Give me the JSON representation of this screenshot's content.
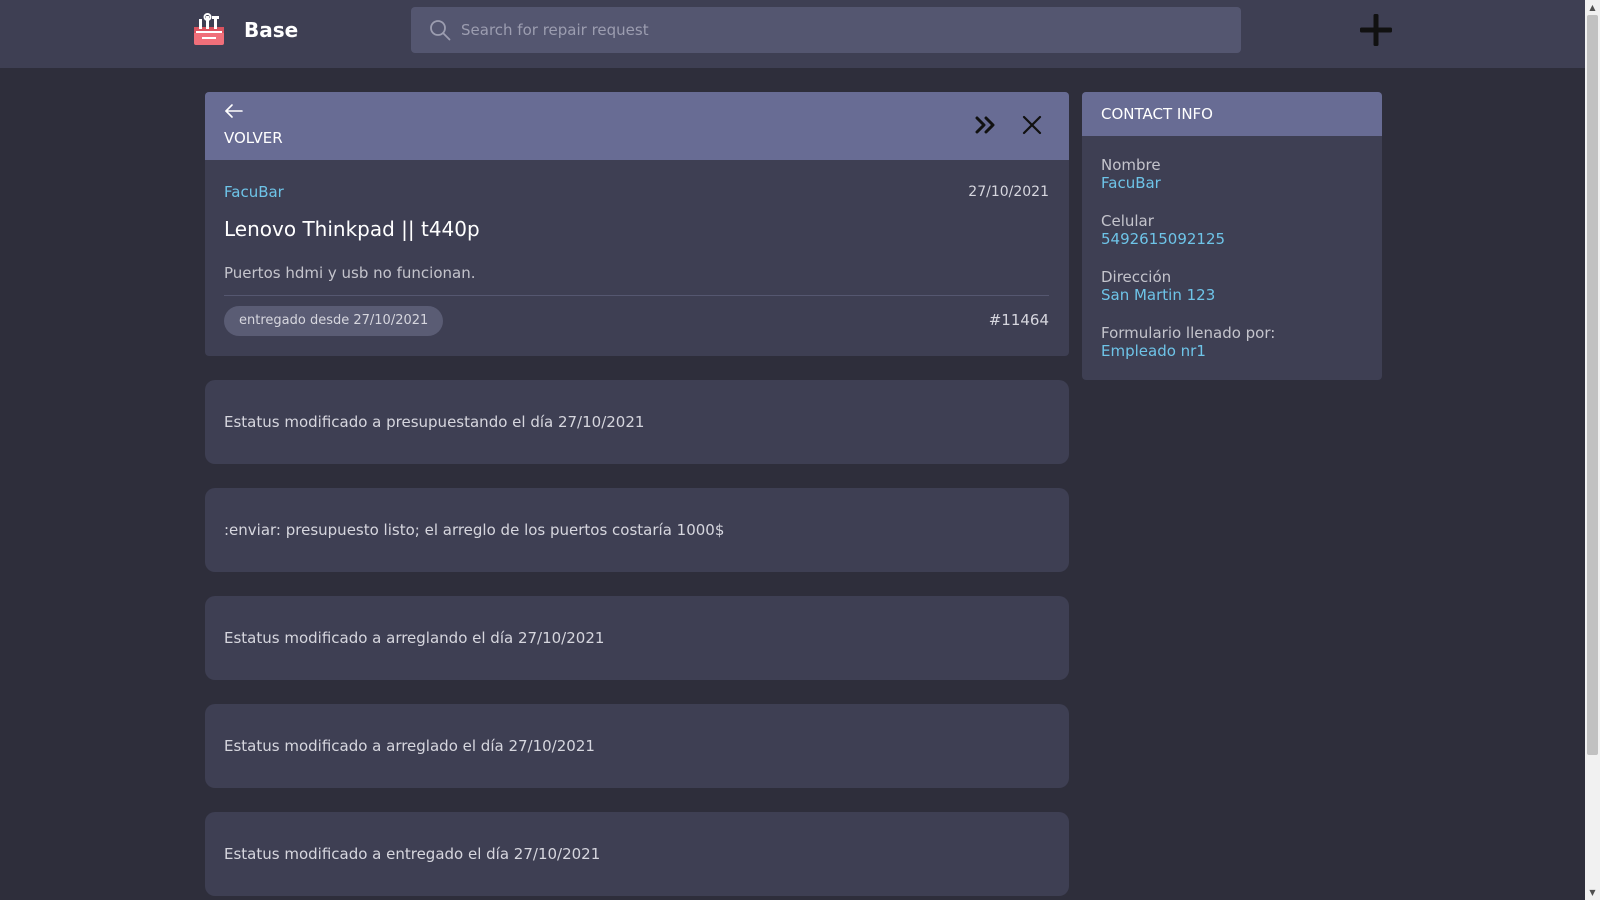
{
  "header": {
    "brand": "Base",
    "search_placeholder": "Search for repair request",
    "search_value": ""
  },
  "detail": {
    "back_label": "VOLVER",
    "customer": "FacuBar",
    "date": "27/10/2021",
    "title": "Lenovo Thinkpad || t440p",
    "description": "Puertos hdmi y usb no funcionan.",
    "status_badge": "entregado desde 27/10/2021",
    "ticket_id": "#11464"
  },
  "timeline": [
    "Estatus modificado a presupuestando el día 27/10/2021",
    ":enviar: presupuesto listo; el arreglo de los puertos costaría 1000$",
    "Estatus modificado a arreglando el día 27/10/2021",
    "Estatus modificado a arreglado el día 27/10/2021",
    "Estatus modificado a entregado el día 27/10/2021"
  ],
  "contact": {
    "title": "CONTACT INFO",
    "fields": [
      {
        "label": "Nombre",
        "value": "FacuBar"
      },
      {
        "label": "Celular",
        "value": "5492615092125"
      },
      {
        "label": "Dirección",
        "value": "San Martin 123"
      },
      {
        "label": "Formulario llenado por:",
        "value": "Empleado nr1"
      }
    ]
  },
  "colors": {
    "background": "#2e2e3b",
    "card": "#3e3f53",
    "card_header": "#686c94",
    "link": "#6ec4e8"
  },
  "icons": [
    "toolbox-logo-icon",
    "search-icon",
    "plus-icon",
    "arrow-left-icon",
    "double-chevron-right-icon",
    "close-icon"
  ]
}
